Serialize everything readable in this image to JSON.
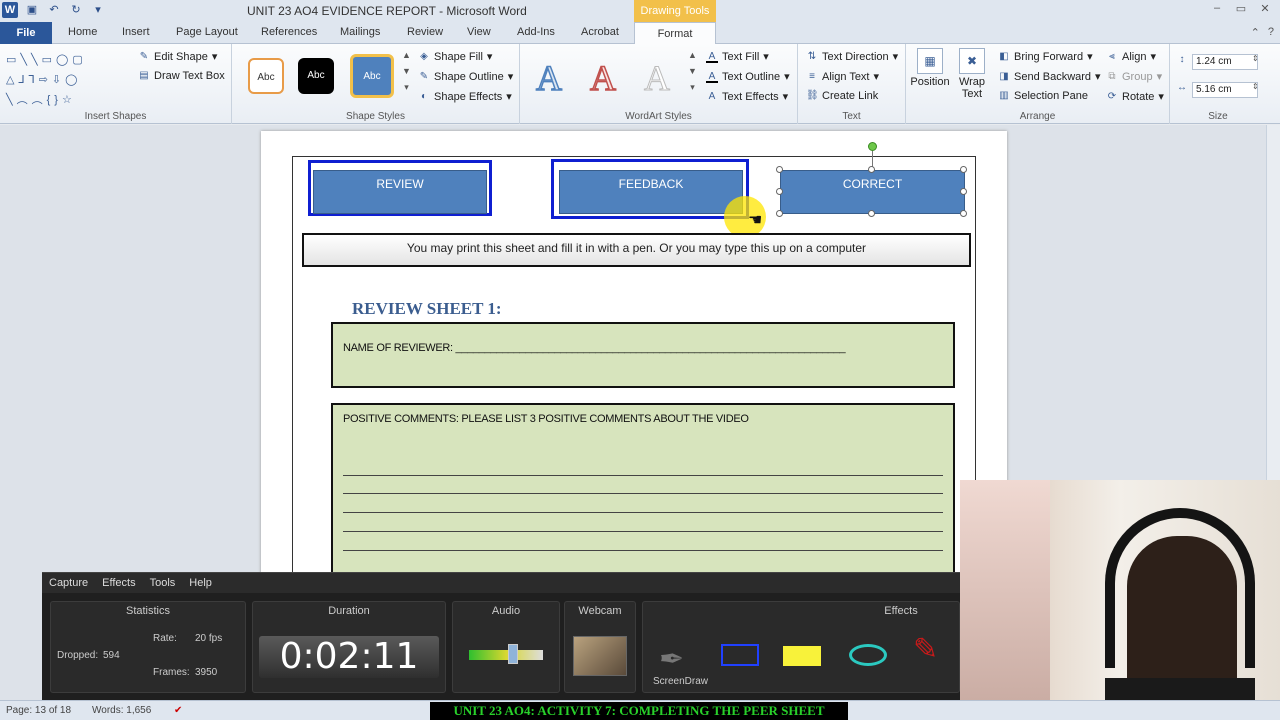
{
  "titlebar": {
    "title": "UNIT 23 AO4 EVIDENCE REPORT  -  Microsoft Word",
    "context_tab": "Drawing Tools",
    "min": "–",
    "max": "▭",
    "close": "✕"
  },
  "tabs": {
    "file": "File",
    "items": [
      "Home",
      "Insert",
      "Page Layout",
      "References",
      "Mailings",
      "Review",
      "View",
      "Add-Ins",
      "Acrobat"
    ],
    "active": "Format"
  },
  "ribbon": {
    "insert_shapes": {
      "label": "Insert Shapes",
      "edit_shape": "Edit Shape",
      "draw_text_box": "Draw Text Box",
      "shapes_row1": "▭╲╲▭◯▢",
      "shapes_row2": "△⅃⅂⇨⇩◯",
      "shapes_row3": "╲︵︵{}☆"
    },
    "shape_styles": {
      "label": "Shape Styles",
      "swatches": [
        "Abc",
        "Abc",
        "Abc"
      ],
      "shape_fill": "Shape Fill",
      "shape_outline": "Shape Outline",
      "shape_effects": "Shape Effects"
    },
    "wordart": {
      "label": "WordArt Styles",
      "letter": "A",
      "text_fill": "Text Fill",
      "text_outline": "Text Outline",
      "text_effects": "Text Effects"
    },
    "text": {
      "label": "Text",
      "text_direction": "Text Direction",
      "align_text": "Align Text",
      "create_link": "Create Link"
    },
    "arrange": {
      "label": "Arrange",
      "position": "Position",
      "wrap_text": "Wrap Text",
      "bring_forward": "Bring Forward",
      "send_backward": "Send Backward",
      "selection_pane": "Selection Pane",
      "align": "Align",
      "group": "Group",
      "rotate": "Rotate"
    },
    "size": {
      "label": "Size",
      "height": "1.24 cm",
      "width": "5.16 cm"
    }
  },
  "document": {
    "buttons": [
      "REVIEW",
      "FEEDBACK",
      "CORRECT"
    ],
    "notice": "You may print this sheet and fill it in with a pen. Or you may type this up on a computer",
    "sheet_title": "REVIEW SHEET 1:",
    "reviewer_label": "NAME OF REVIEWER: ___________________________________________________________________",
    "positive_label": "POSITIVE COMMENTS: PLEASE LIST 3 POSITIVE COMMENTS ABOUT THE VIDEO"
  },
  "recorder": {
    "menu": [
      "Capture",
      "Effects",
      "Tools",
      "Help"
    ],
    "statistics": {
      "title": "Statistics",
      "dropped_label": "Dropped:",
      "dropped": "594",
      "rate_label": "Rate:",
      "rate": "20 fps",
      "frames_label": "Frames:",
      "frames": "3950"
    },
    "duration": {
      "title": "Duration",
      "value": "0:02:11"
    },
    "audio": {
      "title": "Audio",
      "level": 0.6
    },
    "webcam": {
      "title": "Webcam"
    },
    "effects": {
      "title": "Effects",
      "screendraw": "ScreenDraw"
    }
  },
  "statusbar": {
    "page": "Page: 13 of 18",
    "words": "Words: 1,656"
  },
  "caption": "UNIT 23 AO4: ACTIVITY 7: COMPLETING THE PEER SHEET",
  "colors": {
    "file_tab": "#2b579a",
    "context_tab": "#f2c04a",
    "shape_fill": "#4f81bd",
    "selection": "#0f1fd1",
    "green_box": "#d7e4bd",
    "caption_text": "#28d12a"
  }
}
